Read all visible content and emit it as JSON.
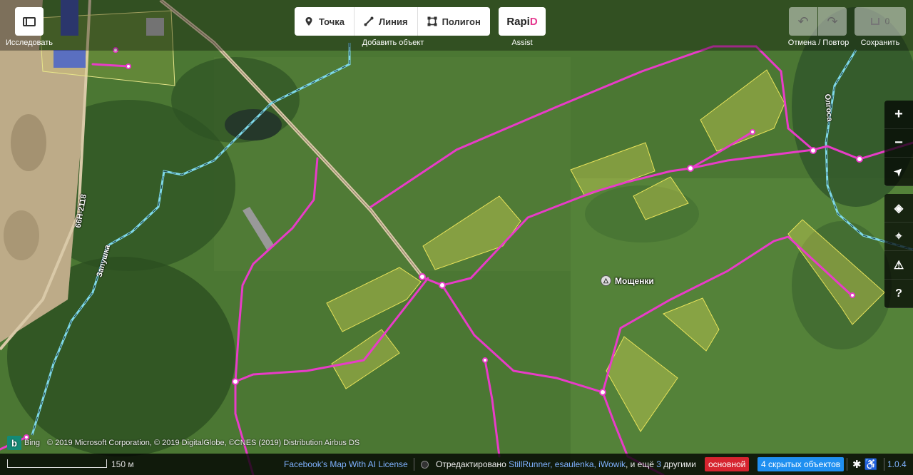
{
  "topbar": {
    "sidebar_caption": "Исследовать",
    "add_caption": "Добавить объект",
    "modes": [
      {
        "label": "Точка",
        "icon": "map-pin-icon"
      },
      {
        "label": "Линия",
        "icon": "line-icon"
      },
      {
        "label": "Полигон",
        "icon": "polygon-icon"
      }
    ],
    "rapid": {
      "logo_main": "Rapi",
      "logo_accent": "D",
      "caption": "Assist"
    },
    "undo_redo_caption": "Отмена / Повтор",
    "save_count": "0",
    "save_caption": "Сохранить"
  },
  "right_controls": {
    "zoom_in": "+",
    "zoom_out": "−",
    "locate": "➤",
    "layers": "◈",
    "map_data": "⌖",
    "issues": "⚠",
    "help": "?"
  },
  "map": {
    "place_label": "Мощенки",
    "road_labels": [
      "66Н-2118",
      "Запушка",
      "Олгоса"
    ]
  },
  "attribution": {
    "bing": "b",
    "bing_label": "Bing",
    "text": "© 2019 Microsoft Corporation, © 2019 DigitalGlobe, ©CNES (2019) Distribution Airbus DS"
  },
  "footer": {
    "scale_label": "150 м",
    "license_link": "Facebook's Map With AI License",
    "edited_prefix": "Отредактировано",
    "editors": "StillRunner, esaulenka, iWowik",
    "and_more": ", и ещё",
    "others_count": "3",
    "others_label": "другими",
    "branch_badge": "основной",
    "hidden_badge": "4 скрытых объектов",
    "version": "1.0.4"
  },
  "colors": {
    "path": "#e83cc8",
    "water": "#7fd9e8",
    "road": "#d9c9a8",
    "residential": "#e9e35a"
  }
}
